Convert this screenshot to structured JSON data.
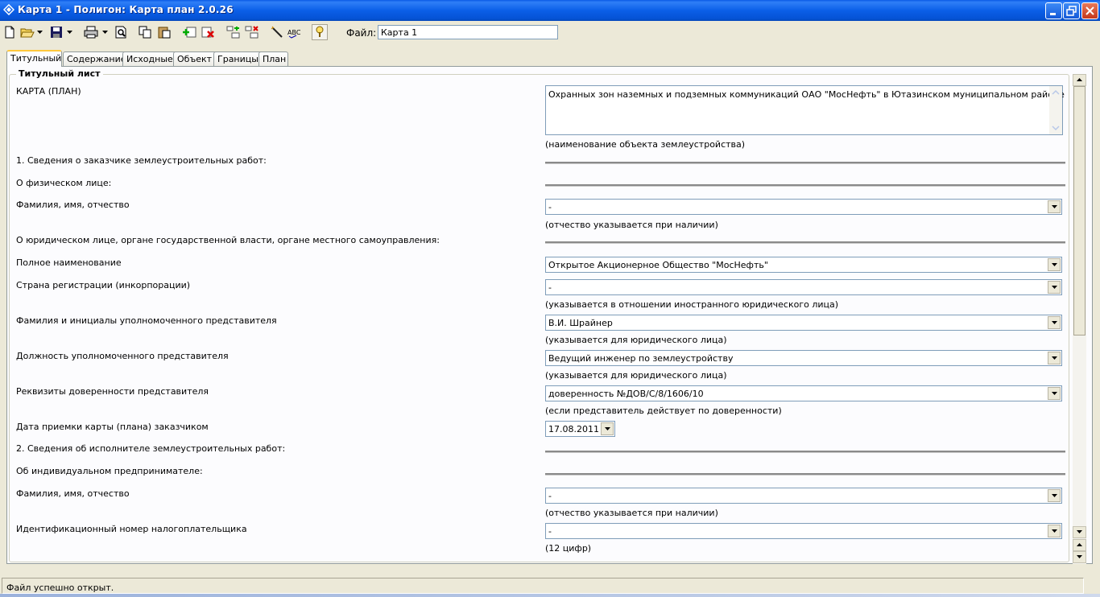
{
  "window": {
    "title": "Карта 1 - Полигон: Карта план 2.0.26"
  },
  "toolbar": {
    "file_label": "Файл:",
    "file_value": "Карта 1"
  },
  "tabs": [
    {
      "label": "Титульный",
      "active": true
    },
    {
      "label": "Содержание"
    },
    {
      "label": "Исходные"
    },
    {
      "label": "Объект"
    },
    {
      "label": "Границы"
    },
    {
      "label": "План"
    }
  ],
  "group": {
    "label": "Титульный лист"
  },
  "form": {
    "map_label": "КАРТА (ПЛАН)",
    "object_name": "Охранных зон наземных и подземных коммуникаций ОАО \"МосНефть\" в Ютазинском муниципальном районе",
    "object_hint": "(наименование объекта землеустройства)",
    "customer_section": "1. Сведения о заказчике землеустроительных работ:",
    "individual_label": "О физическом лице:",
    "fio_label": "Фамилия, имя, отчество",
    "fio_value": "-",
    "fio_hint": "(отчество указывается при наличии)",
    "legal_label": "О юридическом лице, органе государственной власти, органе местного самоуправления:",
    "fullname_label": "Полное наименование",
    "fullname_value": "Открытое Акционерное Общество \"МосНефть\"",
    "country_label": "Страна регистрации (инкорпорации)",
    "country_value": "-",
    "country_hint": "(указывается в отношении иностранного юридического лица)",
    "rep_label": "Фамилия и инициалы уполномоченного представителя",
    "rep_value": "В.И. Шрайнер",
    "rep_hint": "(указывается для юридического лица)",
    "position_label": "Должность уполномоченного представителя",
    "position_value": "Ведущий инженер по землеустройству",
    "position_hint": "(указывается для юридического лица)",
    "proxy_label": "Реквизиты доверенности представителя",
    "proxy_value": "доверенность №ДОВ/С/8/1606/10",
    "proxy_hint": "(если представитель действует по доверенности)",
    "date_label": "Дата приемки карты (плана) заказчиком",
    "date_value": "17.08.2011",
    "contractor_section": "2. Сведения об исполнителе землеустроительных работ:",
    "entrepreneur_label": "Об индивидуальном предпринимателе:",
    "fio2_label": "Фамилия, имя, отчество",
    "fio2_value": "-",
    "fio2_hint": "(отчество указывается при наличии)",
    "inn_label": "Идентификационный номер налогоплательщика",
    "inn_value": "-",
    "inn_hint": "(12 цифр)"
  },
  "status": {
    "text": "Файл успешно открыт."
  }
}
